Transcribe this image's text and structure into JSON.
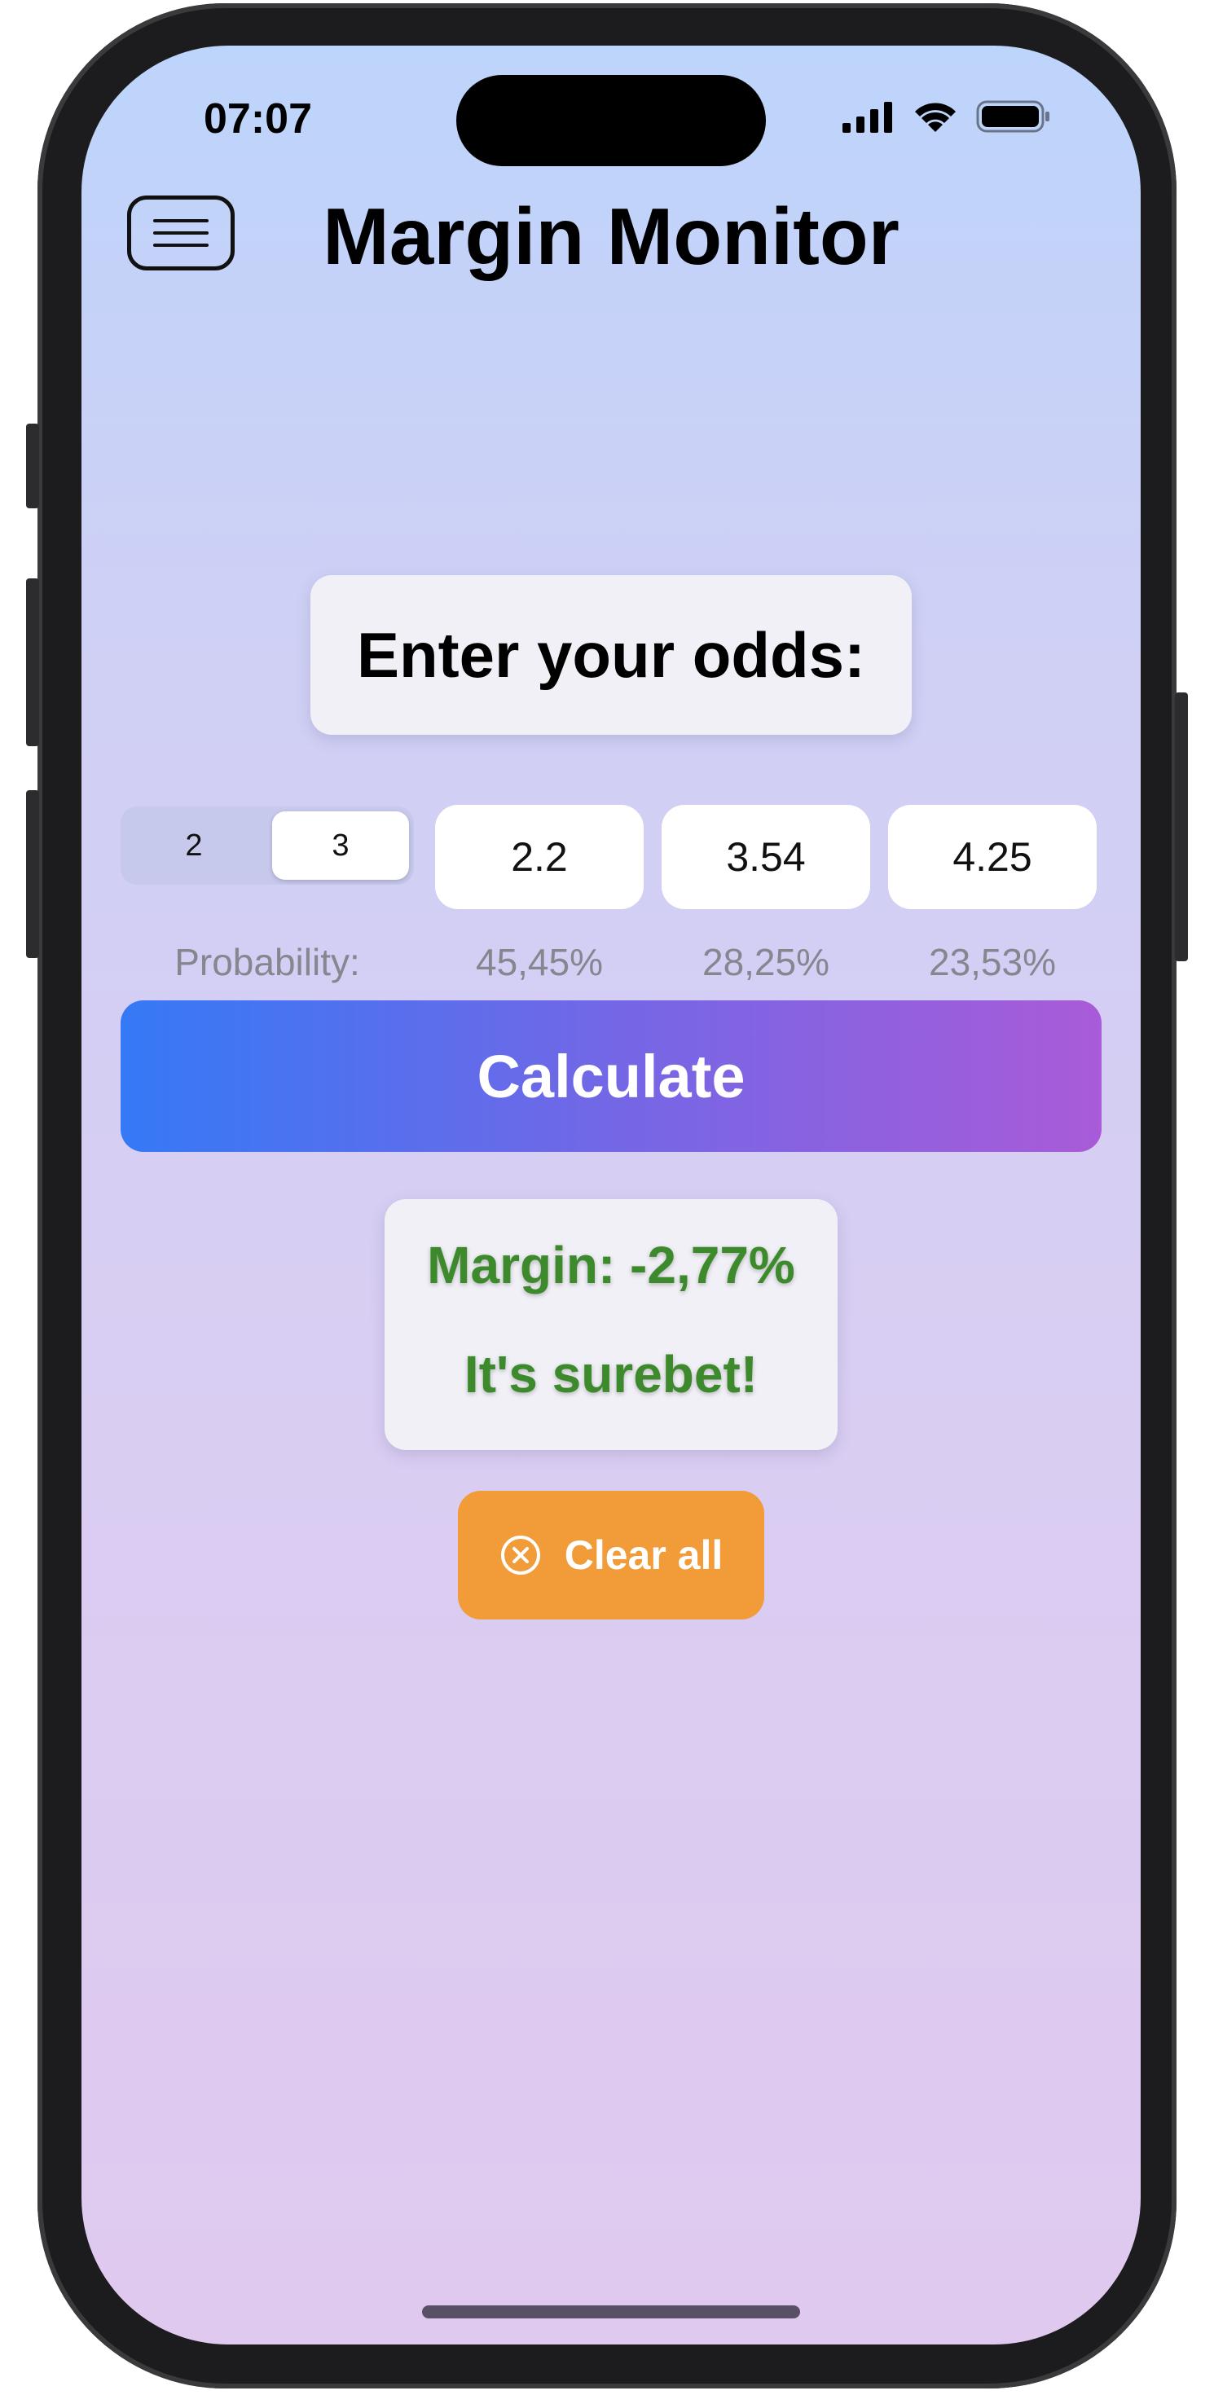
{
  "status_bar": {
    "time": "07:07",
    "icons": [
      "cellular-signal-icon",
      "wifi-icon",
      "battery-icon"
    ]
  },
  "header": {
    "title": "Margin Monitor",
    "menu_icon": "hamburger-menu-icon"
  },
  "prompt": {
    "label": "Enter your odds:"
  },
  "outcomes_selector": {
    "options": [
      "2",
      "3"
    ],
    "selected": "3"
  },
  "odds": {
    "values": [
      "2.2",
      "3.54",
      "4.25"
    ]
  },
  "probability": {
    "label": "Probability:",
    "values": [
      "45,45%",
      "28,25%",
      "23,53%"
    ]
  },
  "calculate_button": {
    "label": "Calculate"
  },
  "result": {
    "margin": "Margin: -2,77%",
    "verdict": "It's surebet!",
    "color": "#3d8a2c"
  },
  "clear_button": {
    "label": "Clear all",
    "icon": "x-circle-icon",
    "color": "#f29b39"
  },
  "colors": {
    "gradient_start": "#3579f6",
    "gradient_end": "#a95bd8",
    "background_top": "#bdd4fb",
    "background_bottom": "#e0c9ef"
  }
}
